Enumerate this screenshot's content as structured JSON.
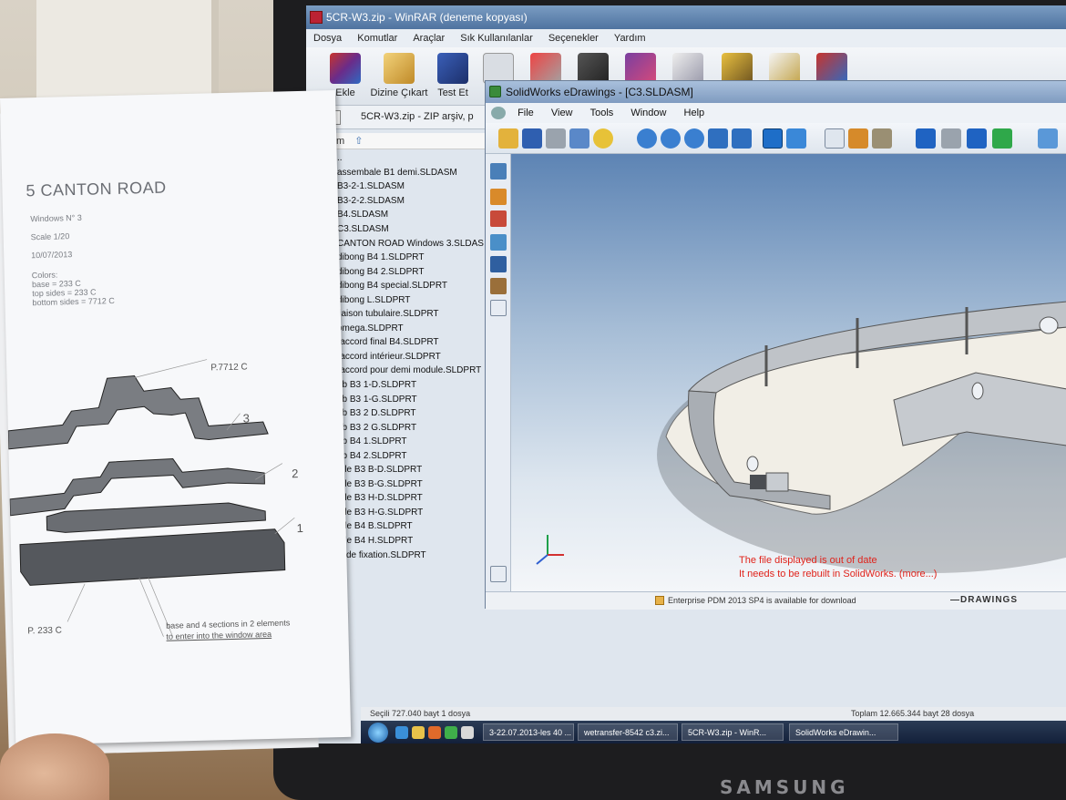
{
  "winrar": {
    "title": "5CR-W3.zip - WinRAR (deneme kopyası)",
    "menu": [
      "Dosya",
      "Komutlar",
      "Araçlar",
      "Sık Kullanılanlar",
      "Seçenekler",
      "Yardım"
    ],
    "toolbar": [
      {
        "label": "Ekle",
        "icon": "archive-icon"
      },
      {
        "label": "Dizine Çıkart",
        "icon": "extract-folder-icon"
      },
      {
        "label": "Test Et",
        "icon": "test-book-icon"
      }
    ],
    "address": "5CR-W3.zip - ZIP arşiv, p",
    "column_name": "İsim",
    "files": [
      "..",
      "assembale B1 demi.SLDASM",
      "B3-2-1.SLDASM",
      "B3-2-2.SLDASM",
      "B4.SLDASM",
      "C3.SLDASM",
      "CANTON ROAD Windows 3.SLDAS",
      "dibong B4 1.SLDPRT",
      "dibong B4 2.SLDPRT",
      "dibong B4 special.SLDPRT",
      "dibong L.SLDPRT",
      "liaison tubulaire.SLDPRT",
      "omega.SLDPRT",
      "raccord final B4.SLDPRT",
      "raccord intérieur.SLDPRT",
      "raccord pour demi module.SLDPRT",
      "rib B3 1-D.SLDPRT",
      "rib B3 1-G.SLDPRT",
      "rib B3 2 D.SLDPRT",
      "rib B3 2 G.SLDPRT",
      "rib B4 1.SLDPRT",
      "rib B4 2.SLDPRT",
      "tole B3 B-D.SLDPRT",
      "tole B3 B-G.SLDPRT",
      "tole B3 H-D.SLDPRT",
      "tole B3 H-G.SLDPRT",
      "tole B4 B.SLDPRT",
      "tole B4 H.SLDPRT",
      "U de fixation.SLDPRT"
    ],
    "status_left": "Seçili 727.040 bayt 1 dosya",
    "status_right": "Toplam 12.665.344 bayt 28 dosya"
  },
  "taskbar": {
    "tasks": [
      "3-22.07.2013-les 40 ...",
      "wetransfer-8542 c3.zi...",
      "5CR-W3.zip - WinR...",
      "SolidWorks eDrawin..."
    ]
  },
  "edrawings": {
    "title": "SolidWorks eDrawings - [C3.SLDASM]",
    "menu": [
      "File",
      "View",
      "Tools",
      "Window",
      "Help"
    ],
    "warning_line1": "The file displayed is out of date",
    "warning_line2": "It needs to be rebuilt in SolidWorks. (more...)",
    "status_pdm": "Enterprise PDM 2013 SP4 is available for download",
    "logo": "DRAWINGS",
    "colors": {
      "warning": "#e0231b",
      "viewport_top": "#5d84b4"
    }
  },
  "paper": {
    "title": "5 CANTON ROAD",
    "lines": [
      "Windows N° 3",
      "Scale 1/20",
      "10/07/2013",
      "Colors:",
      "base = 233 C",
      "top sides = 233 C",
      "bottom sides = 7712 C"
    ],
    "labels": {
      "p7712": "P.7712 C",
      "n3": "3",
      "n2": "2",
      "n1": "1",
      "p233": "P. 233 C",
      "note1": "base and 4 sections in 2 elements",
      "note2": "to enter into the window area"
    }
  },
  "monitor_brand": "SAMSUNG"
}
